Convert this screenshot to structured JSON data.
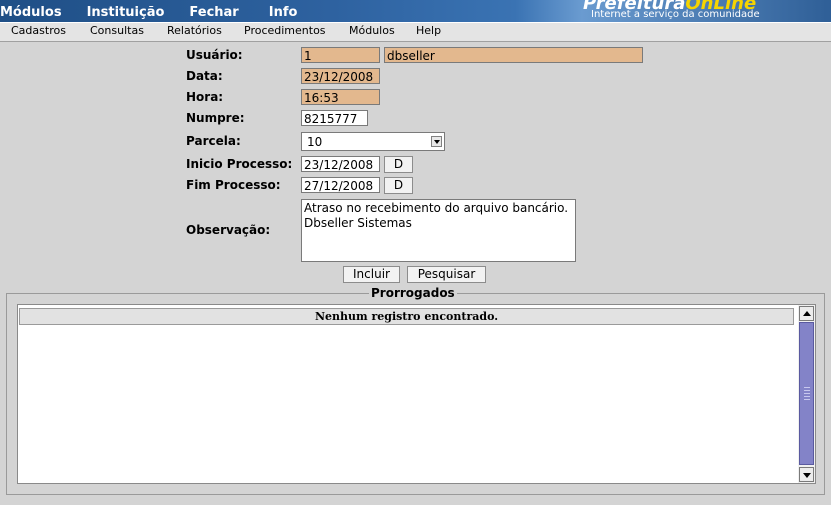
{
  "topnav": {
    "items": [
      "Módulos",
      "Instituição",
      "Fechar",
      "Info"
    ],
    "brand_prefix": "Prefeitura",
    "brand_suffix": "OnLine",
    "brand_tagline": "Internet a serviço da comunidade"
  },
  "menubar": {
    "items": [
      "Cadastros",
      "Consultas",
      "Relatórios",
      "Procedimentos",
      "Módulos",
      "Help"
    ]
  },
  "form": {
    "usuario_label": "Usuário:",
    "usuario_id": "1",
    "usuario_nome": "dbseller",
    "data_label": "Data:",
    "data_value": "23/12/2008",
    "hora_label": "Hora:",
    "hora_value": "16:53",
    "numpre_label": "Numpre:",
    "numpre_value": "8215777",
    "parcela_label": "Parcela:",
    "parcela_value": "10",
    "inicio_label": "Inicio Processo:",
    "inicio_value": "23/12/2008",
    "fim_label": "Fim Processo:",
    "fim_value": "27/12/2008",
    "date_button": "D",
    "observacao_label": "Observação:",
    "observacao_value": "Atraso no recebimento do arquivo bancário. Dbseller Sistemas",
    "incluir_button": "Incluir",
    "pesquisar_button": "Pesquisar"
  },
  "prorrogados": {
    "legend": "Prorrogados",
    "empty_message": "Nenhum registro encontrado."
  },
  "colors": {
    "readonly_bg": "#e3b88e",
    "scroll_thumb": "#8383c8",
    "banner": "#2e62a0"
  }
}
